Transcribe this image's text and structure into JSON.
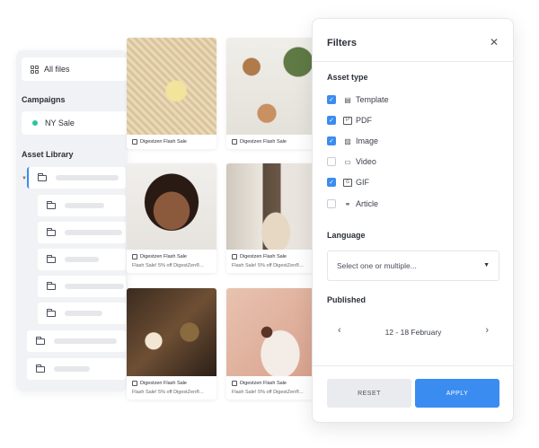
{
  "sidebar": {
    "all_files": "All files",
    "campaigns_heading": "Campaigns",
    "campaign_item": "NY Sale",
    "library_heading": "Asset Library"
  },
  "cards": [
    {
      "title": "Digestzen Flash Sale",
      "subtitle": ""
    },
    {
      "title": "Digestzen Flash Sale",
      "subtitle": ""
    },
    {
      "title": "Digestzen Flash Sale",
      "subtitle": "Flash Sale! 5% off DigestZen®..."
    },
    {
      "title": "Digestzen Flash Sale",
      "subtitle": "Flash Sale! 5% off DigestZen®..."
    },
    {
      "title": "Digestzen Flash Sale",
      "subtitle": "Flash Sale! 5% off DigestZen®..."
    },
    {
      "title": "Digestzen Flash Sale",
      "subtitle": "Flash Sale! 5% off DigestZen®..."
    }
  ],
  "filters": {
    "title": "Filters",
    "asset_type_label": "Asset type",
    "options": [
      {
        "label": "Template",
        "checked": true,
        "icon": "template-icon"
      },
      {
        "label": "PDF",
        "checked": true,
        "icon": "pdf-icon"
      },
      {
        "label": "Image",
        "checked": true,
        "icon": "image-icon"
      },
      {
        "label": "Video",
        "checked": false,
        "icon": "video-icon"
      },
      {
        "label": "GIF",
        "checked": true,
        "icon": "gif-icon"
      },
      {
        "label": "Article",
        "checked": false,
        "icon": "link-icon"
      }
    ],
    "language_label": "Language",
    "language_placeholder": "Select one or multiple...",
    "published_label": "Published",
    "date_range": "12 - 18 February",
    "reset": "RESET",
    "apply": "APPLY"
  },
  "colors": {
    "accent": "#3b8cf0",
    "campaign_dot": "#2ec4a0"
  }
}
